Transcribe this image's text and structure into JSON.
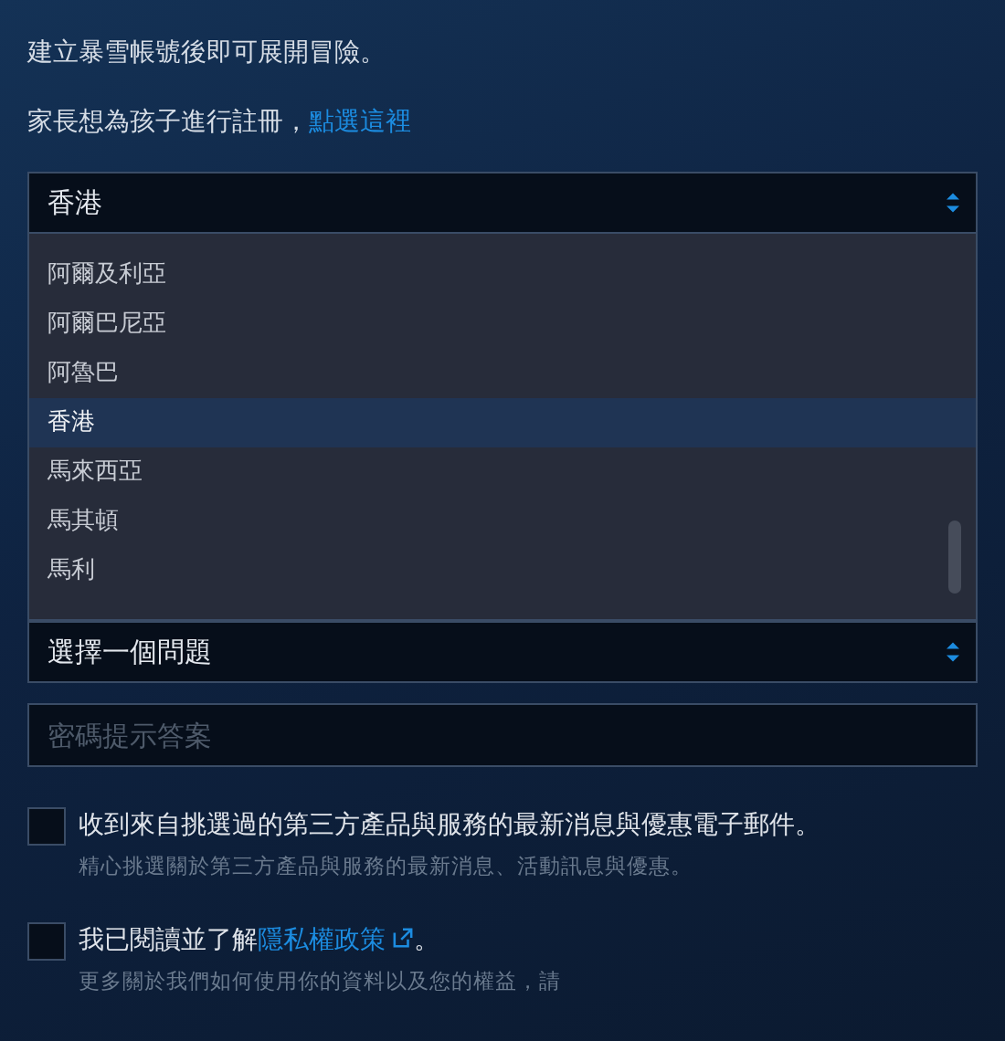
{
  "intro": "建立暴雪帳號後即可展開冒險。",
  "parent_note": {
    "text": "家長想為孩子進行註冊，",
    "link": "點選這裡"
  },
  "country_select": {
    "value": "香港",
    "expanded": true,
    "options": [
      {
        "label": "阿爾及利亞",
        "selected": false
      },
      {
        "label": "阿爾巴尼亞",
        "selected": false
      },
      {
        "label": "阿魯巴",
        "selected": false
      },
      {
        "label": "香港",
        "selected": true
      },
      {
        "label": "馬來西亞",
        "selected": false
      },
      {
        "label": "馬其頓",
        "selected": false
      },
      {
        "label": "馬利",
        "selected": false
      }
    ]
  },
  "question_select": {
    "value": "選擇一個問題"
  },
  "answer_field": {
    "placeholder": "密碼提示答案"
  },
  "checkboxes": [
    {
      "label": "收到來自挑選過的第三方產品與服務的最新消息與優惠電子郵件。",
      "checked": false,
      "note": "精心挑選關於第三方產品與服務的最新消息、活動訊息與優惠。"
    },
    {
      "label": "我已閱讀並了解",
      "link": "隱私權政策",
      "after": "。",
      "checked": false,
      "note": "更多關於我們如何使用你的資料以及您的權益，請"
    }
  ]
}
